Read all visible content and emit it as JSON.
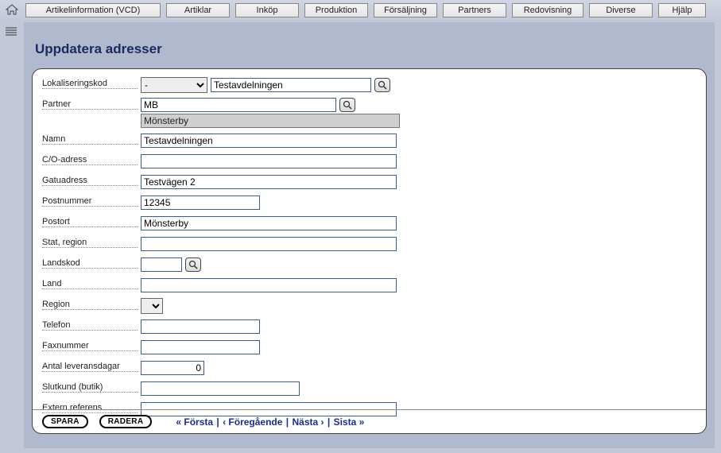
{
  "menu": {
    "items": [
      "Artikelinformation (VCD)",
      "Artiklar",
      "Inköp",
      "Produktion",
      "Försäljning",
      "Partners",
      "Redovisning",
      "Diverse",
      "Hjälp"
    ]
  },
  "page": {
    "title": "Uppdatera adresser"
  },
  "form": {
    "labels": {
      "lokaliseringskod": "Lokaliseringskod",
      "partner": "Partner",
      "namn": "Namn",
      "co_adress": "C/O-adress",
      "gatuadress": "Gatuadress",
      "postnummer": "Postnummer",
      "postort": "Postort",
      "stat_region": "Stat, region",
      "landskod": "Landskod",
      "land": "Land",
      "region": "Region",
      "telefon": "Telefon",
      "faxnummer": "Faxnummer",
      "antal_leveransdagar": "Antal leveransdagar",
      "slutkund": "Slutkund (butik)",
      "extern_referens": "Extern referens"
    },
    "values": {
      "lokaliseringskod_sel": "-",
      "lokaliseringskod_text": "Testavdelningen",
      "partner_code": "MB",
      "partner_name": "Mönsterby",
      "namn": "Testavdelningen",
      "co_adress": "",
      "gatuadress": "Testvägen 2",
      "postnummer": "12345",
      "postort": "Mönsterby",
      "stat_region": "",
      "landskod": "",
      "land": "",
      "region_sel": "",
      "telefon": "",
      "faxnummer": "",
      "antal_leveransdagar": "0",
      "slutkund": "",
      "extern_referens": ""
    }
  },
  "footer": {
    "save": "SPARA",
    "delete": "RADERA",
    "first": "« Första",
    "prev": "‹ Föregående",
    "next": "Nästa ›",
    "last": "Sista »"
  }
}
